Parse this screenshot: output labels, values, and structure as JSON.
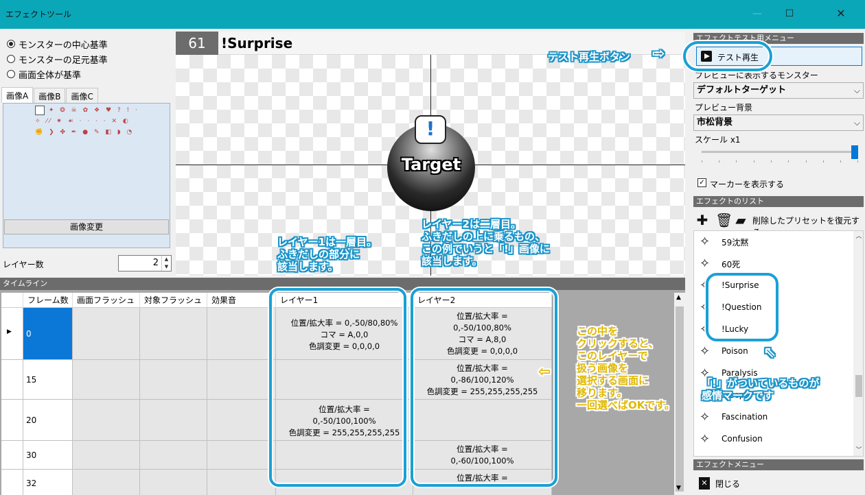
{
  "window": {
    "title": "エフェクトツール",
    "minimize": "—",
    "maximize": "☐",
    "close": "✕"
  },
  "left": {
    "radios": [
      {
        "label": "モンスターの中心基準",
        "selected": true
      },
      {
        "label": "モンスターの足元基準",
        "selected": false
      },
      {
        "label": "画面全体が基準",
        "selected": false
      }
    ],
    "tabs": [
      "画像A",
      "画像B",
      "画像C"
    ],
    "sprite_rows": [
      "✦ ❂ ☠ ✿ ❖ ♥ ? ! ·",
      "✧ ⁄⁄ ✷ ☙ · · · · ✕ ◐",
      "✊ ❯ ✤ ✒ ● ✎ ◧ ◗ ◔"
    ],
    "change_button": "画像変更",
    "layer_count_label": "レイヤー数",
    "layer_count": "2"
  },
  "preview": {
    "number": "61",
    "name": "!Surprise",
    "target_label": "Target",
    "bubble": "!"
  },
  "timeline": {
    "title": "タイムライン",
    "columns": [
      "フレーム数",
      "画面フラッシュ",
      "対象フラッシュ",
      "効果音",
      "レイヤー1",
      "レイヤー2"
    ],
    "rows": [
      {
        "frame": "0",
        "layer1": "位置/拡大率 = 0,-50/80,80%\nコマ = A,0,0\n色調変更 = 0,0,0,0",
        "layer2": "位置/拡大率 =\n0,-50/100,80%\nコマ = A,8,0\n色調変更 = 0,0,0,0"
      },
      {
        "frame": "15",
        "layer1": "",
        "layer2": "位置/拡大率 =\n0,-86/100,120%\n色調変更 = 255,255,255,255"
      },
      {
        "frame": "20",
        "layer1": "位置/拡大率 =\n0,-50/100,100%\n色調変更 = 255,255,255,255",
        "layer2": ""
      },
      {
        "frame": "30",
        "layer1": "",
        "layer2": "位置/拡大率 =\n0,-60/100,100%"
      },
      {
        "frame": "32",
        "layer1": "",
        "layer2": "位置/拡大率 ="
      }
    ]
  },
  "right": {
    "test_menu_title": "エフェクトテスト用メニュー",
    "play_button": "テスト再生",
    "monster_label": "プレビューに表示するモンスター",
    "monster_value": "デフォルトターゲット",
    "bg_label": "プレビュー背景",
    "bg_value": "市松背景",
    "scale_label": "スケール x1",
    "scale_level": 1.0,
    "marker_label": "マーカーを表示する",
    "marker_checked": true,
    "list_title": "エフェクトのリスト",
    "restore_label": "削除したプリセットを復元する",
    "effects": [
      "59沈黙",
      "60死",
      "!Surprise",
      "!Question",
      "!Lucky",
      "Poison",
      "Paralysis",
      "Sleep",
      "Fascination",
      "Confusion"
    ],
    "effect_menu_title": "エフェクトメニュー",
    "close_label": "閉じる"
  },
  "annotations": {
    "test_play": "テスト再生ボタン",
    "layer1": [
      "レイヤー1は一層目。",
      "ふきだしの部分に",
      "該当します。"
    ],
    "layer2": [
      "レイヤー2は二層目。",
      "ふきだしの上に乗るもの、",
      "この例でいうと「!」画像に",
      "該当します。"
    ],
    "click_hint": [
      "この中を",
      "クリックすると、",
      "このレイヤーで",
      "扱う画像を",
      "選択する画面に",
      "移ります。",
      "一回選べばOKです。"
    ],
    "emotion": [
      "「!」がついているものが",
      "感情マークです"
    ]
  },
  "colors": {
    "accent": "#0aa7b9",
    "annotation": "#1a94c9",
    "hint": "#e0b800",
    "selected": "#0b78d7"
  }
}
